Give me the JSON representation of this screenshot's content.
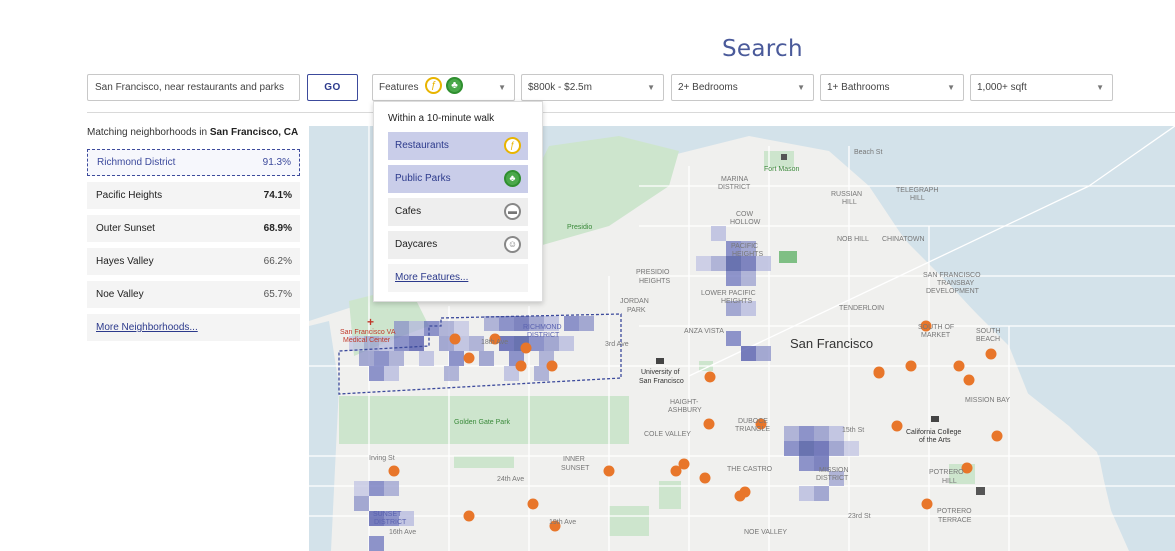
{
  "page": {
    "title": "Search"
  },
  "search": {
    "value": "San Francisco, near restaurants and parks",
    "go_label": "GO"
  },
  "filters": {
    "features_label": "Features",
    "price": "$800k - $2.5m",
    "bedrooms": "2+ Bedrooms",
    "bathrooms": "1+ Bathrooms",
    "sqft": "1,000+ sqft"
  },
  "features_dropdown": {
    "heading": "Within a 10-minute walk",
    "items": [
      {
        "label": "Restaurants",
        "icon": "fork-knife-icon",
        "selected": true
      },
      {
        "label": "Public Parks",
        "icon": "tree-icon",
        "selected": true
      },
      {
        "label": "Cafes",
        "icon": "coffee-cup-icon",
        "selected": false
      },
      {
        "label": "Daycares",
        "icon": "baby-icon",
        "selected": false
      }
    ],
    "more_label": "More Features..."
  },
  "neighborhoods": {
    "intro": "Matching neighborhoods in ",
    "city": "San Francisco, CA",
    "items": [
      {
        "name": "Richmond District",
        "score": "91.3%"
      },
      {
        "name": "Pacific Heights",
        "score": "74.1%"
      },
      {
        "name": "Outer Sunset",
        "score": "68.9%"
      },
      {
        "name": "Hayes Valley",
        "score": "66.2%"
      },
      {
        "name": "Noe Valley",
        "score": "65.7%"
      }
    ],
    "more_label": "More Neighborhoods..."
  },
  "map": {
    "city_label": "San Francisco",
    "labels": [
      "Beach St",
      "Fort Mason",
      "MARINA",
      "DISTRICT",
      "RUSSIAN",
      "HILL",
      "TELEGRAPH",
      "HILL",
      "COW",
      "HOLLOW",
      "NOB HILL",
      "CHINATOWN",
      "PACIFIC",
      "HEIGHTS",
      "PRESIDIO",
      "HEIGHTS",
      "JORDAN",
      "PARK",
      "LOWER PACIFIC",
      "HEIGHTS",
      "SAN FRANCISCO",
      "TRANSBAY",
      "DEVELOPMENT",
      "TENDERLOIN",
      "SOUTH OF",
      "MARKET",
      "SOUTH",
      "BEACH",
      "ANZA VISTA",
      "RICHMOND",
      "DISTRICT",
      "University of",
      "San Francisco",
      "HAIGHT-",
      "ASHBURY",
      "COLE VALLEY",
      "DUBOCE",
      "TRIANGLE",
      "MISSION BAY",
      "California College",
      "of the Arts",
      "POTRERO",
      "HILL",
      "THE CASTRO",
      "MISSION",
      "DISTRICT",
      "INNER",
      "SUNSET",
      "NOE VALLEY",
      "POTRERO",
      "TERRACE",
      "SUNSET",
      "DISTRICT",
      "San Francisco VA",
      "Medical Center",
      "Golden Gate Park",
      "Presidio",
      "Irving St",
      "24th Ave",
      "19th Ave",
      "18th Ave",
      "3rd Ave",
      "15th St",
      "23rd St",
      "16th Ave"
    ]
  },
  "colors": {
    "accent": "#3c4a9c",
    "pin": "#e8762a",
    "park": "#cfe6cf",
    "water": "#cfe0e8"
  }
}
